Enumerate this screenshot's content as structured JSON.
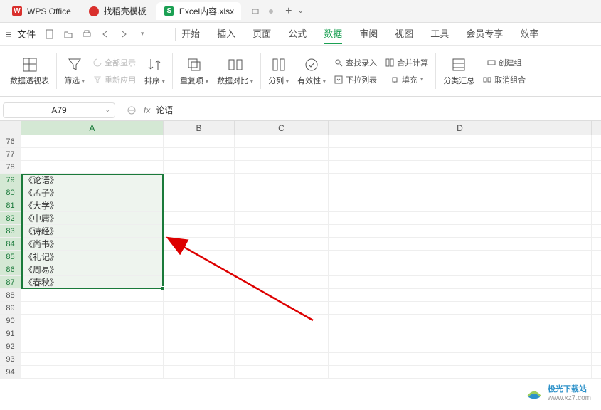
{
  "titlebar": {
    "tabs": [
      {
        "label": "WPS Office"
      },
      {
        "label": "找稻壳模板"
      },
      {
        "label": "Excel内容.xlsx"
      }
    ],
    "plus": "+",
    "down": "⌄"
  },
  "menubar": {
    "hamburger": "≡",
    "file": "文件",
    "qat": [
      "new",
      "open",
      "print",
      "undo",
      "redo",
      "caret"
    ],
    "tabs": [
      "开始",
      "插入",
      "页面",
      "公式",
      "数据",
      "审阅",
      "视图",
      "工具",
      "会员专享",
      "效率"
    ],
    "active": "数据"
  },
  "ribbon": {
    "pivotTable": "数据透视表",
    "filter": "筛选",
    "showAll": "全部显示",
    "reapply": "重新应用",
    "sort": "排序",
    "dupe": "重复项",
    "compare": "数据对比",
    "split": "分列",
    "validate": "有效性",
    "lookupInsert": "查找录入",
    "dropdown": "下拉列表",
    "consolidate": "合并计算",
    "fill": "填充",
    "subtotal": "分类汇总",
    "group": "创建组",
    "ungroup": "取消组合"
  },
  "formula_bar": {
    "name": "A79",
    "fx": "fx",
    "value": "论语"
  },
  "columns": [
    "A",
    "B",
    "C",
    "D"
  ],
  "rows_start": 76,
  "rows_end": 94,
  "sel_start": 79,
  "sel_end": 87,
  "cells": [
    "《论语》",
    "《孟子》",
    "《大学》",
    "《中庸》",
    "《诗经》",
    "《尚书》",
    "《礼记》",
    "《周易》",
    "《春秋》"
  ],
  "watermark": {
    "name": "极光下载站",
    "url": "www.xz7.com"
  }
}
